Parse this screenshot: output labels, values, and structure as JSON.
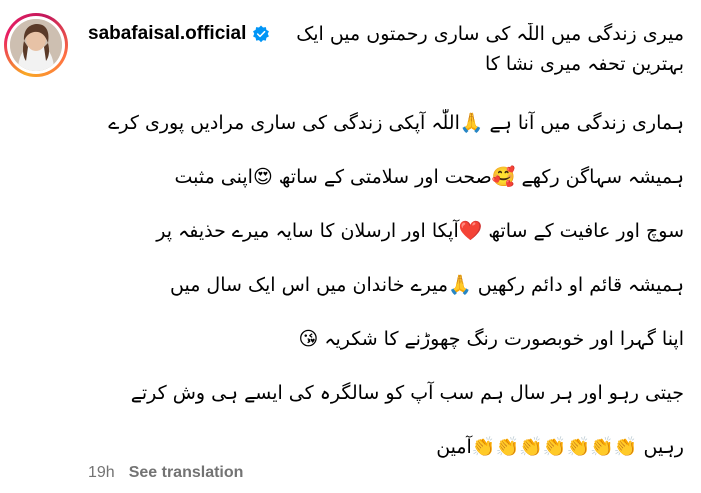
{
  "post": {
    "username": "sabafaisal.official",
    "caption_lines": [
      "میری زندگی میں اللّٰہ کی ساری رحمتوں میں ایک",
      "بہترین تحفہ میری نشا کا",
      "ہماری زندگی میں آنا ہے 🙏اللّٰہ آپکی زندگی کی ساری مرادیں پوری کرے",
      "ہمیشہ سہاگن رکھے 🥰صحت اور سلامتی کے ساتھ 😍اپنی مثبت",
      "سوچ اور عافیت کے ساتھ ❤️آپکا اور ارسلان کا سایہ میرے حذیفہ پر",
      "ہمیشہ قائم او دائم رکھیں 🙏میرے خاندان میں اس ایک سال میں",
      "اپنا گہرا اور خوبصورت رنگ چھوڑنے کا شکریہ 😘",
      "جیتی رہو اور ہر سال ہم سب آپ کو سالگرہ کی ایسے ہی وش کرتے",
      "رہیں 👏👏👏👏👏👏👏آمین"
    ],
    "time_ago": "19h",
    "see_translation": "See translation"
  },
  "colors": {
    "verified_badge": "#0095f6",
    "meta_text": "#737373",
    "avatar_ring": "#e91e63"
  },
  "icons": {
    "verified": "verified-badge-icon",
    "avatar": "profile-avatar"
  }
}
